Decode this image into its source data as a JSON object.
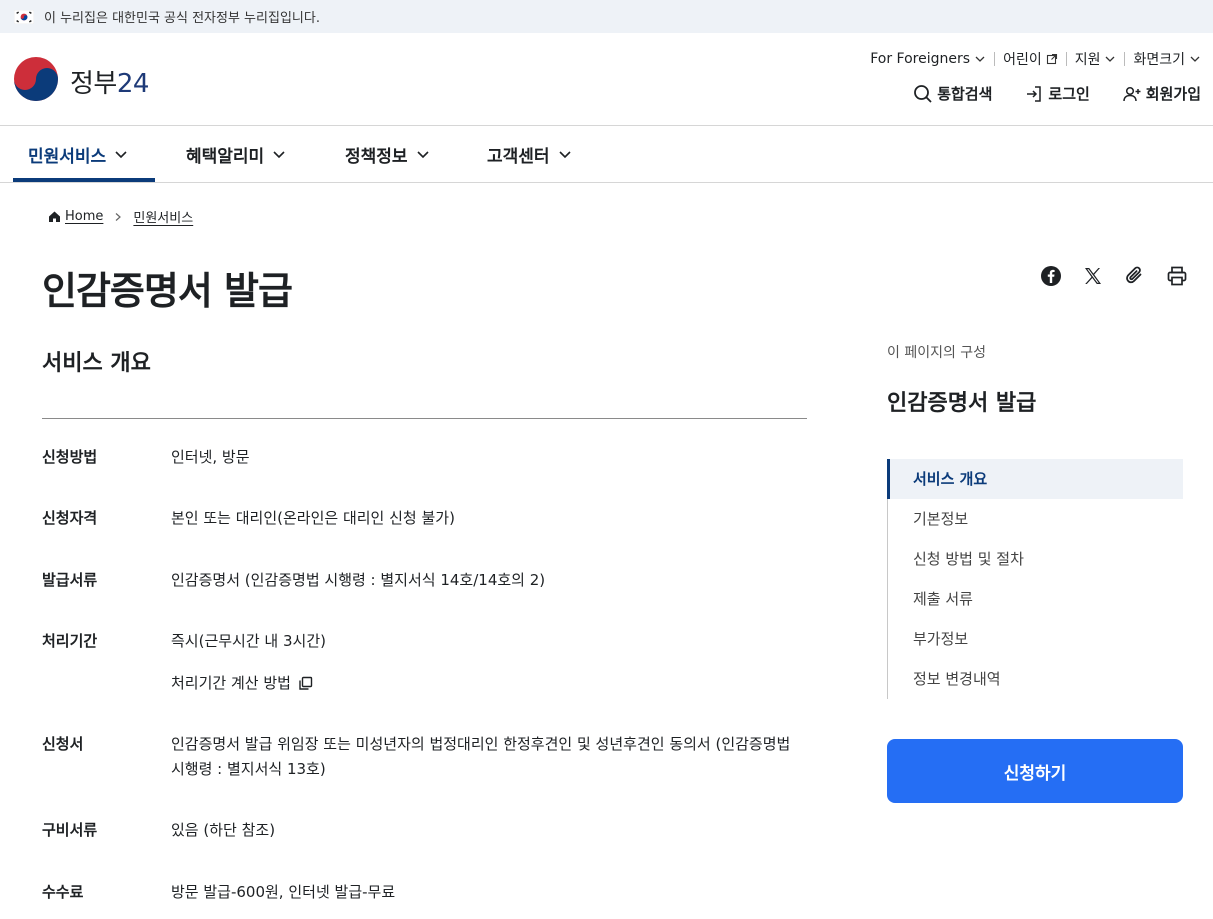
{
  "banner": {
    "text": "이 누리집은 대한민국 공식 전자정부 누리집입니다."
  },
  "logo": {
    "text_main": "정부",
    "text_num": "24"
  },
  "utility": [
    {
      "label": "For Foreigners",
      "icon": "chevron-down-icon"
    },
    {
      "label": "어린이",
      "icon": "external-link-icon"
    },
    {
      "label": "지원",
      "icon": "chevron-down-icon"
    },
    {
      "label": "화면크기",
      "icon": "chevron-down-icon"
    }
  ],
  "actions": {
    "search": "통합검색",
    "login": "로그인",
    "signup": "회원가입"
  },
  "gnb": [
    {
      "label": "민원서비스",
      "active": true
    },
    {
      "label": "혜택알리미",
      "active": false
    },
    {
      "label": "정책정보",
      "active": false
    },
    {
      "label": "고객센터",
      "active": false
    }
  ],
  "breadcrumb": {
    "home": "Home",
    "current": "민원서비스"
  },
  "page_title": "인감증명서 발급",
  "section_title": "서비스 개요",
  "info_rows": [
    {
      "label": "신청방법",
      "value": "인터넷, 방문"
    },
    {
      "label": "신청자격",
      "value": "본인 또는 대리인(온라인은 대리인 신청 불가)"
    },
    {
      "label": "발급서류",
      "value": "인감증명서 (인감증명법 시행령 : 별지서식 14호/14호의 2)"
    },
    {
      "label": "처리기간",
      "value": "즉시(근무시간 내 3시간)",
      "sub": "처리기간 계산 방법"
    },
    {
      "label": "신청서",
      "value": "인감증명서 발급 위임장 또는 미성년자의 법정대리인 한정후견인 및 성년후견인 동의서 (인감증명법 시행령 : 별지서식 13호)"
    },
    {
      "label": "구비서류",
      "value": "있음 (하단 참조)"
    },
    {
      "label": "수수료",
      "value": "방문 발급-600원, 인터넷 발급-무료"
    }
  ],
  "toc": {
    "caption": "이 페이지의 구성",
    "title": "인감증명서 발급",
    "items": [
      {
        "label": "서비스 개요",
        "active": true
      },
      {
        "label": "기본정보",
        "active": false
      },
      {
        "label": "신청 방법 및 절차",
        "active": false
      },
      {
        "label": "제출 서류",
        "active": false
      },
      {
        "label": "부가정보",
        "active": false
      },
      {
        "label": "정보 변경내역",
        "active": false
      }
    ]
  },
  "apply_button": "신청하기",
  "colors": {
    "primary_navy": "#0b3b7a",
    "primary_blue": "#256ef4",
    "banner_bg": "#eef2f7"
  }
}
